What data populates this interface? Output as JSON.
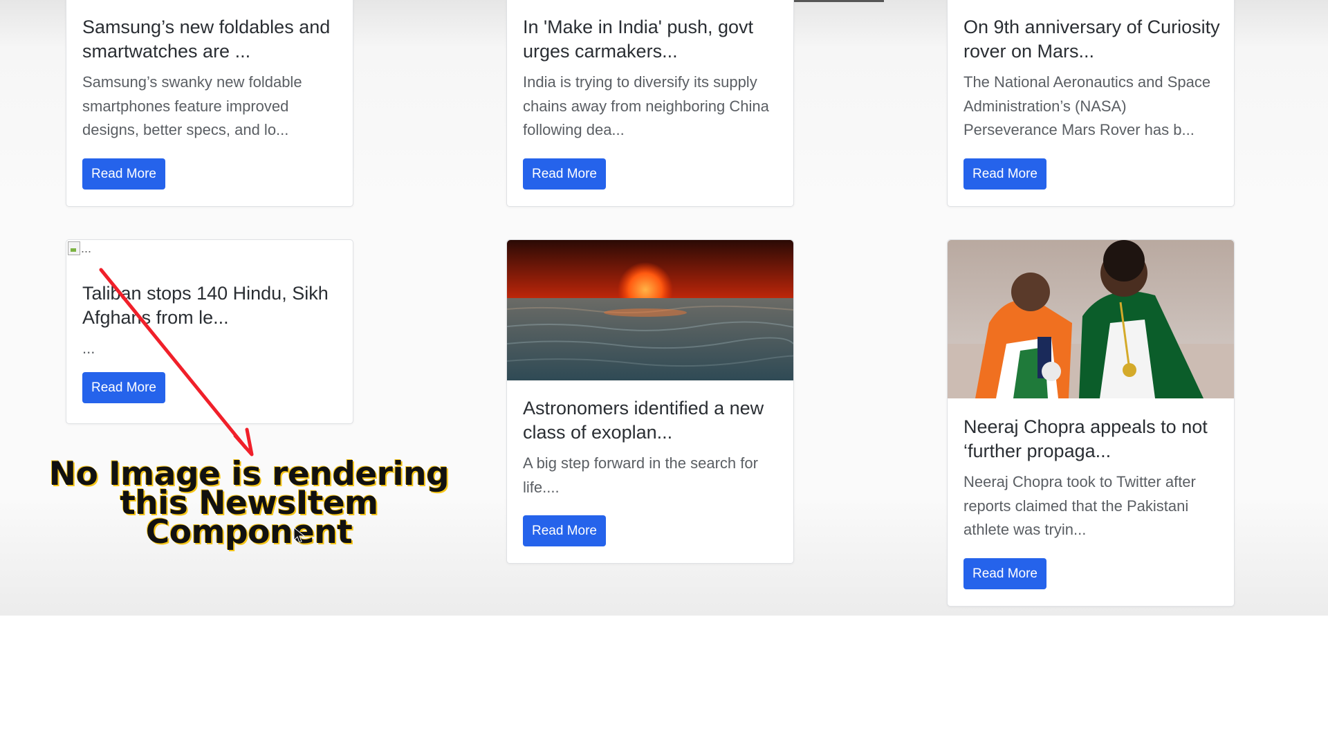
{
  "cards": [
    {
      "title": "Samsung’s new foldables and smartwatches are ...",
      "description": "Samsung’s swanky new foldable smartphones feature improved designs, better specs, and lo...",
      "button": "Read More"
    },
    {
      "title": "In 'Make in India' push, govt urges carmakers...",
      "description": "India is trying to diversify its supply chains away from neighboring China following dea...",
      "button": "Read More"
    },
    {
      "title": "On 9th anniversary of Curiosity rover on Mars...",
      "description": "The National Aeronautics and Space Administration’s (NASA) Perseverance Mars Rover has b...",
      "button": "Read More"
    },
    {
      "image_alt": "...",
      "title": "Taliban stops 140 Hindu, Sikh Afghans from le...",
      "description": "...",
      "button": "Read More"
    },
    {
      "title": "Astronomers identified a new class of exoplan...",
      "description": "A big step forward in the search for life....",
      "button": "Read More"
    },
    {
      "title": "Neeraj Chopra appeals to not ‘further propaga...",
      "description": "Neeraj Chopra took to Twitter after reports claimed that the Pakistani athlete was tryin...",
      "button": "Read More"
    }
  ],
  "annotation": {
    "line1": "No Image is rendering",
    "line2": "this NewsItem",
    "line3": "Component",
    "arrow_color": "#f0202a",
    "text_outline_color": "#f5c518"
  },
  "colors": {
    "button": "#2563eb",
    "card_border": "#dfe1e4"
  }
}
